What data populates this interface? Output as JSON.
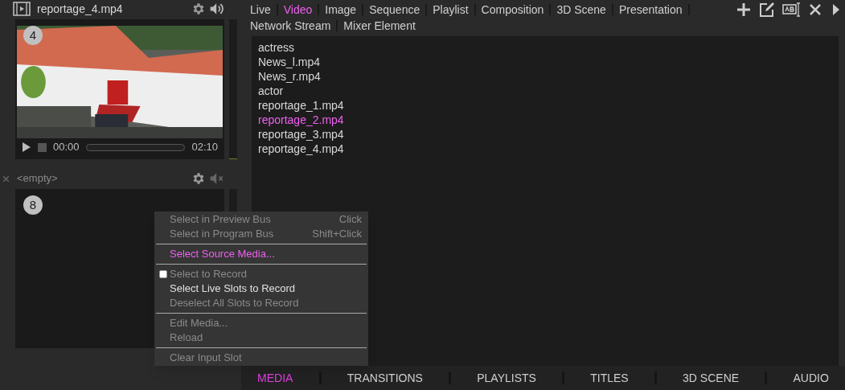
{
  "slots": [
    {
      "number": "4",
      "title": "reportage_4.mp4",
      "muted": false,
      "empty": false,
      "player": {
        "time": "00:00",
        "duration": "02:10"
      }
    },
    {
      "number": "8",
      "title": "<empty>",
      "muted": true,
      "empty": true
    }
  ],
  "source_tabs": [
    {
      "label": "Live",
      "selected": false
    },
    {
      "label": "Video",
      "selected": true
    },
    {
      "label": "Image",
      "selected": false
    },
    {
      "label": "Sequence",
      "selected": false
    },
    {
      "label": "Playlist",
      "selected": false
    },
    {
      "label": "Composition",
      "selected": false
    },
    {
      "label": "3D Scene",
      "selected": false
    },
    {
      "label": "Presentation",
      "selected": false
    },
    {
      "label": "Network Stream",
      "selected": false
    },
    {
      "label": "Mixer Element",
      "selected": false
    }
  ],
  "files": [
    {
      "name": "actress",
      "selected": false
    },
    {
      "name": "News_l.mp4",
      "selected": false
    },
    {
      "name": "News_r.mp4",
      "selected": false
    },
    {
      "name": "actor",
      "selected": false
    },
    {
      "name": "reportage_1.mp4",
      "selected": false
    },
    {
      "name": "reportage_2.mp4",
      "selected": true
    },
    {
      "name": "reportage_3.mp4",
      "selected": false
    },
    {
      "name": "reportage_4.mp4",
      "selected": false
    }
  ],
  "bottom_tabs": [
    {
      "label": "MEDIA",
      "selected": true
    },
    {
      "label": "TRANSITIONS",
      "selected": false
    },
    {
      "label": "PLAYLISTS",
      "selected": false
    },
    {
      "label": "TITLES",
      "selected": false
    },
    {
      "label": "3D SCENE",
      "selected": false
    },
    {
      "label": "AUDIO",
      "selected": false
    }
  ],
  "context_menu": [
    {
      "kind": "item",
      "label": "Select in Preview Bus",
      "shortcut": "Click",
      "disabled": true,
      "highlighted": false
    },
    {
      "kind": "item",
      "label": "Select in Program Bus",
      "shortcut": "Shift+Click",
      "disabled": true,
      "highlighted": false
    },
    {
      "kind": "separator"
    },
    {
      "kind": "item",
      "label": "Select Source Media...",
      "disabled": false,
      "highlighted": true
    },
    {
      "kind": "separator"
    },
    {
      "kind": "check",
      "label": "Select to Record",
      "checked": false,
      "disabled": true,
      "highlighted": false
    },
    {
      "kind": "item",
      "label": "Select Live Slots to Record",
      "disabled": false,
      "highlighted": false
    },
    {
      "kind": "item",
      "label": "Deselect All Slots to Record",
      "disabled": true,
      "highlighted": false
    },
    {
      "kind": "separator"
    },
    {
      "kind": "item",
      "label": "Edit Media...",
      "disabled": true,
      "highlighted": false
    },
    {
      "kind": "item",
      "label": "Reload",
      "disabled": true,
      "highlighted": false
    },
    {
      "kind": "separator"
    },
    {
      "kind": "item",
      "label": "Clear Input Slot",
      "disabled": true,
      "highlighted": false
    }
  ]
}
